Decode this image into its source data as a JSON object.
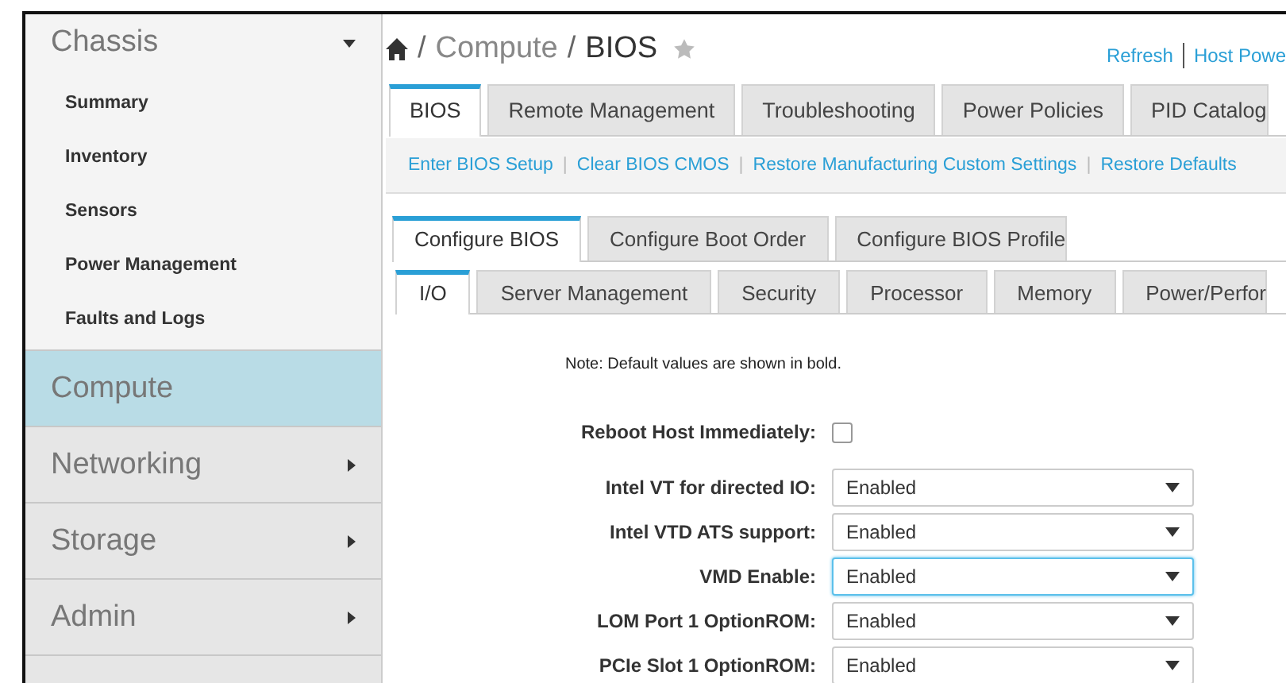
{
  "sidebar": {
    "sections": [
      {
        "label": "Chassis",
        "expanded": true,
        "selected": false,
        "items": [
          "Summary",
          "Inventory",
          "Sensors",
          "Power Management",
          "Faults and Logs"
        ]
      },
      {
        "label": "Compute",
        "selected": true
      },
      {
        "label": "Networking",
        "expanded": false,
        "selected": false
      },
      {
        "label": "Storage",
        "expanded": false,
        "selected": false
      },
      {
        "label": "Admin",
        "expanded": false,
        "selected": false
      }
    ]
  },
  "breadcrumb": {
    "items": [
      "Compute",
      "BIOS"
    ],
    "separator": "/"
  },
  "header_actions": [
    "Refresh",
    "Host Powe"
  ],
  "tabs": [
    {
      "label": "BIOS",
      "selected": true
    },
    {
      "label": "Remote Management",
      "selected": false
    },
    {
      "label": "Troubleshooting",
      "selected": false
    },
    {
      "label": "Power Policies",
      "selected": false
    },
    {
      "label": "PID Catalog",
      "selected": false
    }
  ],
  "action_separator": "|",
  "actions": [
    "Enter BIOS Setup",
    "Clear BIOS CMOS",
    "Restore Manufacturing Custom Settings",
    "Restore Defaults"
  ],
  "bios_tabs": [
    {
      "label": "Configure BIOS",
      "selected": true
    },
    {
      "label": "Configure Boot Order",
      "selected": false
    },
    {
      "label": "Configure BIOS Profile",
      "selected": false
    }
  ],
  "category_tabs": [
    {
      "label": "I/O",
      "selected": true
    },
    {
      "label": "Server Management",
      "selected": false
    },
    {
      "label": "Security",
      "selected": false
    },
    {
      "label": "Processor",
      "selected": false
    },
    {
      "label": "Memory",
      "selected": false
    },
    {
      "label": "Power/Perfor",
      "selected": false
    }
  ],
  "note": "Note: Default values are shown in bold.",
  "reboot": {
    "label": "Reboot Host Immediately:",
    "checked": false
  },
  "settings": [
    {
      "label": "Intel VT for directed IO:",
      "value": "Enabled",
      "focused": false
    },
    {
      "label": "Intel VTD ATS support:",
      "value": "Enabled",
      "focused": false
    },
    {
      "label": "VMD Enable:",
      "value": "Enabled",
      "focused": true
    },
    {
      "label": "LOM Port 1 OptionROM:",
      "value": "Enabled",
      "focused": false
    },
    {
      "label": "PCIe Slot 1 OptionROM:",
      "value": "Enabled",
      "focused": false
    }
  ]
}
